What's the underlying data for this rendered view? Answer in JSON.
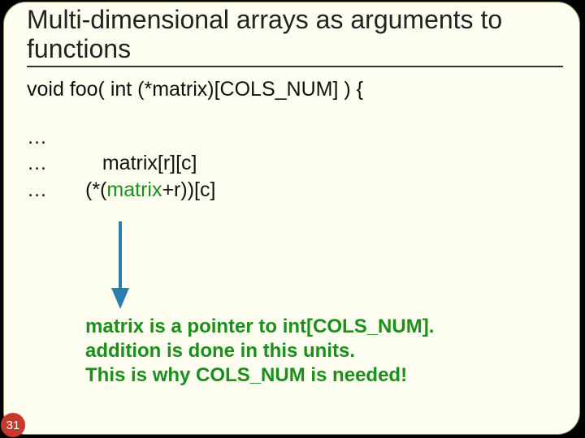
{
  "title": "Multi-dimensional arrays as arguments to functions",
  "signature": "void foo( int (*matrix)[COLS_NUM] ) {",
  "rows": {
    "dots": "…",
    "line2_tail": "matrix[r][c]",
    "line3": {
      "p1": "(*(",
      "p2": "matrix",
      "p3": "+r",
      "p4": "))[c]"
    }
  },
  "explain": {
    "l1_a": "matrix is a pointer to int[COLS_NUM].",
    "l2": "addition is done in this units.",
    "l3": "This is why COLS_NUM is needed!"
  },
  "page_number": "31"
}
